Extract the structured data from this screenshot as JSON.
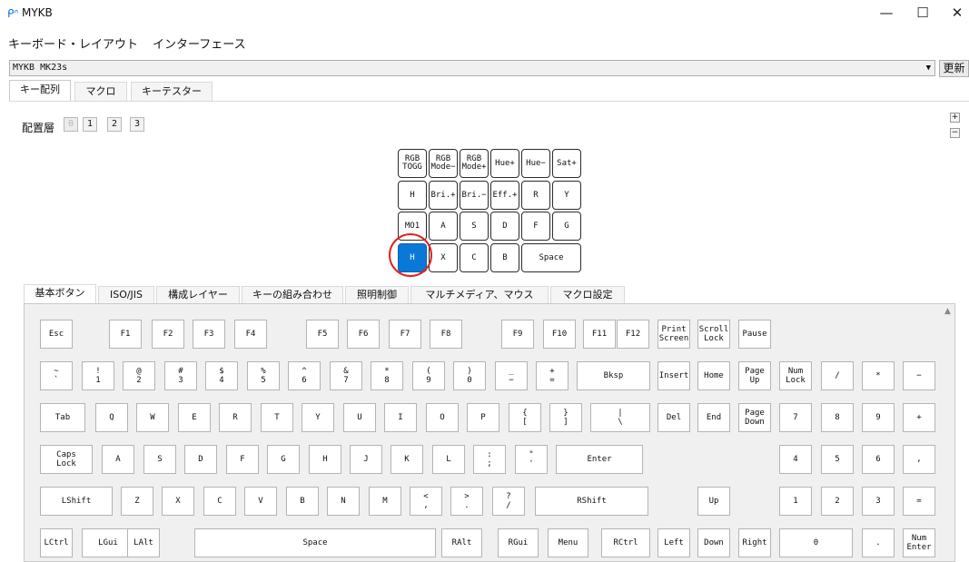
{
  "titlebar": {
    "title": "MYKB",
    "minimize": "—",
    "maximize": "☐",
    "close": "✕"
  },
  "menubar": [
    "キーボード・レイアウト",
    "インターフェース"
  ],
  "device": {
    "selected": "MYKB MK23s",
    "refresh_label": "更新"
  },
  "top_tabs": [
    "キー配列",
    "マクロ",
    "キーテスター"
  ],
  "layer": {
    "label": "配置層",
    "layers": [
      "0",
      "1",
      "2",
      "3"
    ],
    "zoom_in": "+",
    "zoom_out": "−"
  },
  "mini_keyboard": {
    "rows": [
      [
        "RGB\nTOGG",
        "RGB\nMode−",
        "RGB\nMode+",
        "Hue+",
        "Hue−",
        "Sat+"
      ],
      [
        "H",
        "Bri.+",
        "Bri.−",
        "Eff.+",
        "R",
        "Y"
      ],
      [
        "MO1",
        "A",
        "S",
        "D",
        "F",
        "G"
      ],
      [
        "H",
        "X",
        "C",
        "B",
        "Space"
      ]
    ],
    "selected_key": "H"
  },
  "bottom_tabs": [
    "基本ボタン",
    "ISO/JIS",
    "構成レイヤー",
    "キーの組み合わせ",
    "照明制御",
    "マルチメディア、マウス",
    "マクロ設定"
  ],
  "keycodes": [
    [
      "Esc",
      "F1",
      "F2",
      "F3",
      "F4",
      "F5",
      "F6",
      "F7",
      "F8",
      "F9",
      "F10",
      "F11",
      "F12",
      "Print\nScreen",
      "Scroll\nLock",
      "Pause"
    ],
    [
      "~\n`",
      "!\n1",
      "@\n2",
      "#\n3",
      "$\n4",
      "%\n5",
      "^\n6",
      "&\n7",
      "*\n8",
      "(\n9",
      ")\n0",
      "_\n−",
      "+\n=",
      "Bksp",
      "Insert",
      "Home",
      "Page\nUp",
      "Num\nLock",
      "/",
      "*",
      "−"
    ],
    [
      "Tab",
      "Q",
      "W",
      "E",
      "R",
      "T",
      "Y",
      "U",
      "I",
      "O",
      "P",
      "{\n[",
      "}\n]",
      "|\n\\",
      "Del",
      "End",
      "Page\nDown",
      "7",
      "8",
      "9",
      "+"
    ],
    [
      "Caps\nLock",
      "A",
      "S",
      "D",
      "F",
      "G",
      "H",
      "J",
      "K",
      "L",
      ":\n;",
      "\"\n'",
      "Enter",
      "4",
      "5",
      "6",
      ","
    ],
    [
      "LShift",
      "Z",
      "X",
      "C",
      "V",
      "B",
      "N",
      "M",
      "<\n,",
      ">\n.",
      "?\n/",
      "RShift",
      "Up",
      "1",
      "2",
      "3",
      "="
    ],
    [
      "LCtrl",
      "LGui",
      "LAlt",
      "Space",
      "RAlt",
      "RGui",
      "Menu",
      "RCtrl",
      "Left",
      "Down",
      "Right",
      "0",
      ".",
      "Num\nEnter"
    ]
  ]
}
